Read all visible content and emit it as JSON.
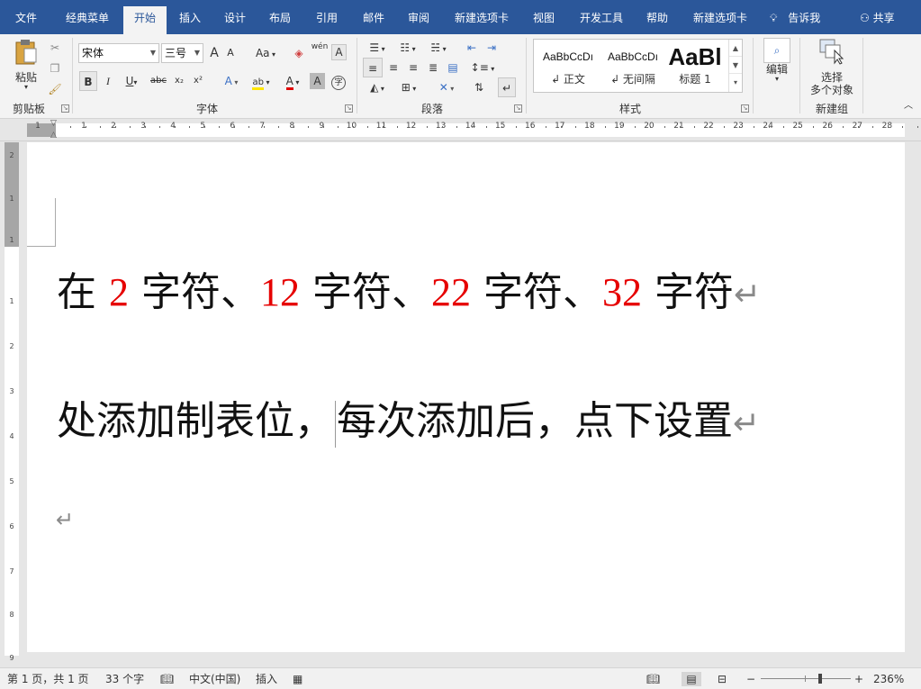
{
  "tabs": [
    "文件",
    "经典菜单",
    "开始",
    "插入",
    "设计",
    "布局",
    "引用",
    "邮件",
    "审阅",
    "新建选项卡",
    "视图",
    "开发工具",
    "帮助",
    "新建选项卡"
  ],
  "active_tab_index": 2,
  "tell_me": "告诉我",
  "share": "共享",
  "ribbon": {
    "clipboard": {
      "paste": "粘贴",
      "label": "剪贴板"
    },
    "font": {
      "name": "宋体",
      "size": "三号",
      "label": "字体",
      "bold": "B",
      "italic": "I",
      "underline": "U",
      "strike": "abc",
      "subscript": "x₂",
      "superscript": "x²",
      "grow": "A",
      "shrink": "A",
      "case": "Aa",
      "phonetic": "wén",
      "enclose": "字",
      "border_char": "A",
      "font_color": "A",
      "highlight": "ab",
      "effects": "A",
      "shade_char": "A"
    },
    "paragraph": {
      "label": "段落"
    },
    "styles": {
      "label": "样式",
      "items": [
        {
          "sample": "AaBbCcDı",
          "name": "↲ 正文"
        },
        {
          "sample": "AaBbCcDı",
          "name": "↲ 无间隔"
        },
        {
          "sample": "AaBl",
          "name": "标题 1"
        }
      ]
    },
    "editing": {
      "label": "编辑"
    },
    "newgroup": {
      "select_line1": "选择",
      "select_line2": "多个对象",
      "label": "新建组"
    }
  },
  "ruler_numbers": [
    "1",
    "1",
    "2",
    "3",
    "4",
    "5",
    "6",
    "7",
    "8",
    "9",
    "10",
    "11",
    "12",
    "13",
    "14",
    "15",
    "16",
    "17",
    "18",
    "19",
    "20",
    "21",
    "22",
    "23",
    "24",
    "25",
    "26",
    "27",
    "28"
  ],
  "vruler_numbers": [
    "2",
    "1",
    "1",
    "1",
    "2",
    "3",
    "4",
    "5",
    "6",
    "7",
    "8",
    "9"
  ],
  "document": {
    "line1": [
      {
        "t": "在 ",
        "red": false
      },
      {
        "t": "2",
        "red": true
      },
      {
        "t": " 字符、",
        "red": false
      },
      {
        "t": "12",
        "red": true
      },
      {
        "t": " 字符、",
        "red": false
      },
      {
        "t": "22",
        "red": true
      },
      {
        "t": " 字符、",
        "red": false
      },
      {
        "t": "32",
        "red": true
      },
      {
        "t": " 字符",
        "red": false
      }
    ],
    "line2_before_cursor": "处添加制表位，",
    "line2_after_cursor": "每次添加后，点下设置",
    "pilcrow": "↵"
  },
  "status": {
    "page": "第 1 页，共 1 页",
    "words": "33 个字",
    "language": "中文(中国)",
    "mode": "插入",
    "zoom": "236%"
  }
}
